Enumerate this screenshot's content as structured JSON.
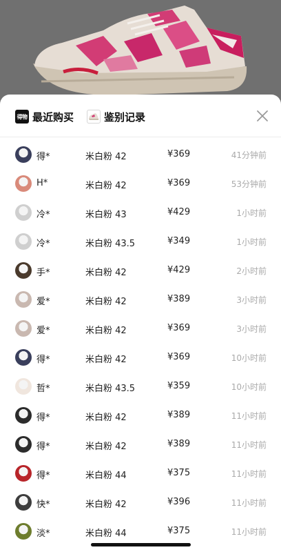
{
  "tabs": [
    {
      "label": "最近购买",
      "icon": "dewu-logo-icon",
      "logo_text": "得物"
    },
    {
      "label": "鉴别记录",
      "icon": "shoe-thumbnail-icon"
    }
  ],
  "close_icon": "close-icon",
  "records": [
    {
      "name": "得*",
      "variant": "米白粉 42",
      "price": "¥369",
      "time": "41分钟前",
      "avatar_color": "#3a3f5c"
    },
    {
      "name": "H*",
      "variant": "米白粉 42",
      "price": "¥369",
      "time": "53分钟前",
      "avatar_color": "#d98a7a"
    },
    {
      "name": "冷*",
      "variant": "米白粉 43",
      "price": "¥429",
      "time": "1小时前",
      "avatar_color": "#cfcfcf"
    },
    {
      "name": "冷*",
      "variant": "米白粉 43.5",
      "price": "¥349",
      "time": "1小时前",
      "avatar_color": "#cfcfcf"
    },
    {
      "name": "手*",
      "variant": "米白粉 42",
      "price": "¥429",
      "time": "2小时前",
      "avatar_color": "#4a3a2c"
    },
    {
      "name": "爱*",
      "variant": "米白粉 42",
      "price": "¥389",
      "time": "3小时前",
      "avatar_color": "#c9b8b0"
    },
    {
      "name": "爱*",
      "variant": "米白粉 42",
      "price": "¥369",
      "time": "3小时前",
      "avatar_color": "#c9b8b0"
    },
    {
      "name": "得*",
      "variant": "米白粉 42",
      "price": "¥369",
      "time": "10小时前",
      "avatar_color": "#3a3f5c"
    },
    {
      "name": "哲*",
      "variant": "米白粉 43.5",
      "price": "¥359",
      "time": "10小时前",
      "avatar_color": "#f0e6de"
    },
    {
      "name": "得*",
      "variant": "米白粉 42",
      "price": "¥389",
      "time": "11小时前",
      "avatar_color": "#2c2c2c"
    },
    {
      "name": "得*",
      "variant": "米白粉 42",
      "price": "¥389",
      "time": "11小时前",
      "avatar_color": "#2c2c2c"
    },
    {
      "name": "得*",
      "variant": "米白粉 44",
      "price": "¥375",
      "time": "11小时前",
      "avatar_color": "#b8252a"
    },
    {
      "name": "快*",
      "variant": "米白粉 42",
      "price": "¥396",
      "time": "11小时前",
      "avatar_color": "#3d3d3d"
    },
    {
      "name": "淡*",
      "variant": "米白粉 44",
      "price": "¥375",
      "time": "11小时前",
      "avatar_color": "#6e7d2e"
    }
  ]
}
